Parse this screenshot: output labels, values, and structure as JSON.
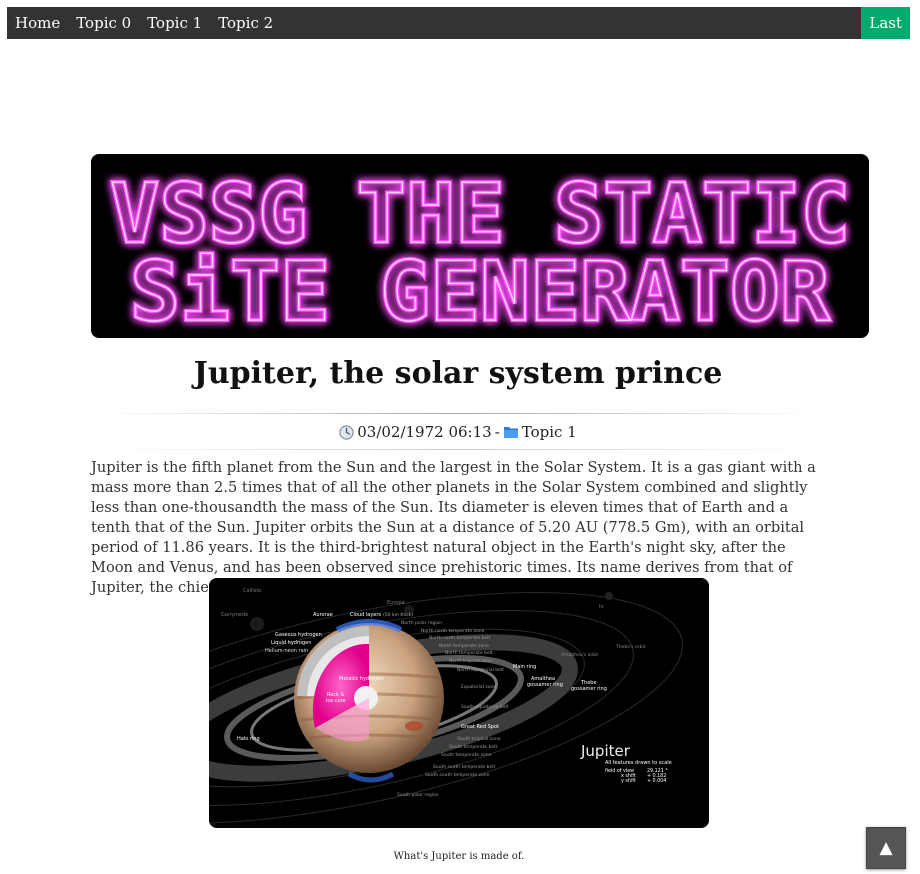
{
  "nav": {
    "items": [
      "Home",
      "Topic 0",
      "Topic 1",
      "Topic 2"
    ],
    "last_label": "Last"
  },
  "banner": {
    "line1": "VSSG THE STATIC",
    "line2": "SiTE GENERATOR",
    "glow_color": "#ff33ff"
  },
  "post": {
    "title": "Jupiter, the solar system prince",
    "date": "03/02/1972 06:13",
    "separator": "-",
    "category": "Topic 1",
    "body": "Jupiter is the fifth planet from the Sun and the largest in the Solar System. It is a gas giant with a mass more than 2.5 times that of all the other planets in the Solar System combined and slightly less than one-thousandth the mass of the Sun. Its diameter is eleven times that of Earth and a tenth that of the Sun. Jupiter orbits the Sun at a distance of 5.20 AU (778.5 Gm), with an orbital period of 11.86 years. It is the third-brightest natural object in the Earth's night sky, after the Moon and Venus, and has been observed since prehistoric times. Its name derives from that of Jupiter, the chief deity of ancient Roman religion.",
    "caption": "What's Jupiter is made of."
  },
  "figure": {
    "title": "Jupiter",
    "subtitle": "All features drawn to scale",
    "fov_label": "field of view",
    "fov_value": "29.121 °",
    "xshift_label": "x shift",
    "xshift_value": "+ 0.182",
    "yshift_label": "y shift",
    "yshift_value": "+ 0.004",
    "labels": {
      "callisto": "Callisto",
      "ganymede": "Ganymede",
      "europa": "Europa",
      "io": "Io",
      "aurorae": "Aurorae",
      "cloud_layers": "Cloud layers",
      "cloud_depth": "(50 km thick)",
      "gaseous_hydrogen": "Gaseous hydrogen",
      "liquid_hydrogen": "Liquid hydrogen",
      "helium_neon_rain": "Helium-neon rain",
      "metallic_hydrogen": "Metallic hydrogen",
      "rock_ice_core_1": "Rock &",
      "rock_ice_core_2": "ice core",
      "north_polar": "North polar region",
      "nn_temp_zone": "North north temperate zone",
      "nn_temp_belt": "North north temperate belt",
      "n_temp_zone": "North temperate zone",
      "n_temp_belt": "North temperate belt",
      "n_trop_zone": "North tropical zone",
      "n_eq_belt": "North equatorial belt",
      "eq_zone": "Equatorial zone",
      "s_eq_belt": "South equatorial belt",
      "grs": "Great Red Spot",
      "s_trop_zone": "South tropical zone",
      "s_temp_belt": "South temperate belt",
      "s_temp_zone": "South temperate zone",
      "ss_temp_belt": "South south temperate belt",
      "ss_temp_zone": "South south temperate zone",
      "south_polar": "South polar region",
      "main_ring": "Main ring",
      "amalthea_orbit": "Amalthea's orbit",
      "thebe_orbit": "Thebe's orbit",
      "amalthea_ring_1": "Amalthea",
      "amalthea_ring_2": "gossamer ring",
      "thebe_ring_1": "Thebe",
      "thebe_ring_2": "gossamer ring",
      "halo_ring": "Halo ring"
    }
  },
  "back_to_top": "▲",
  "colors": {
    "navbar": "#333333",
    "active": "#04aa6d",
    "folder": "#2b7bd6"
  }
}
